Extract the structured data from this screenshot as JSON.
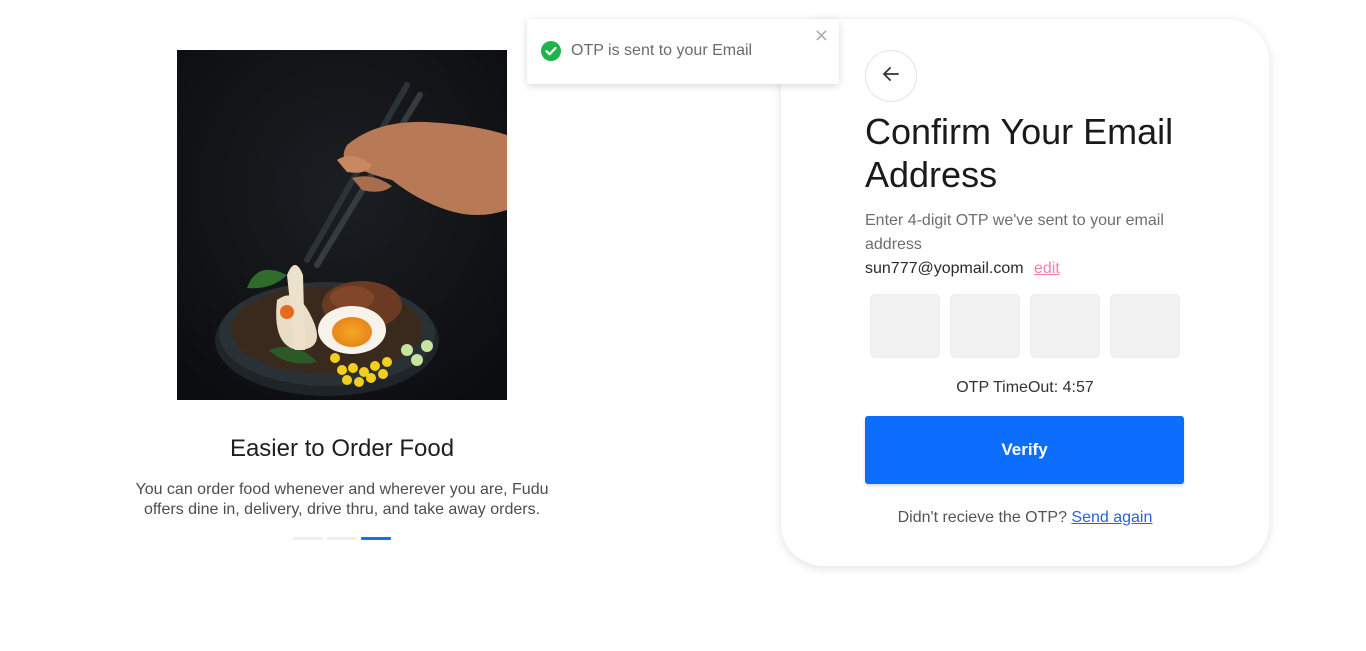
{
  "toast": {
    "message": "OTP is sent to your Email",
    "close_symbol": "×",
    "status_color": "#1fb34a",
    "icon": "check-circle-icon"
  },
  "carousel": {
    "image_icon": "ramen-bowl-photo",
    "title": "Easier to Order Food",
    "description": "You can order food whenever and wherever you are, Fudu offers dine in, delivery, drive thru, and take away orders.",
    "slide_count": 3,
    "active_slide": 3,
    "accent_color": "#1570ef"
  },
  "card": {
    "back_icon": "arrow-left-icon",
    "title": "Confirm Your Email Address",
    "subtitle": "Enter 4-digit OTP we've sent to your email address",
    "email": "sun777@yopmail.com",
    "edit_label": "edit",
    "otp_digits": [
      "",
      "",
      "",
      ""
    ],
    "timeout_label": "OTP TimeOut: 4:57",
    "verify_label": "Verify",
    "verify_color": "#0d6efd",
    "resend_prompt": "Didn't recieve the OTP?",
    "resend_label": "Send again"
  }
}
